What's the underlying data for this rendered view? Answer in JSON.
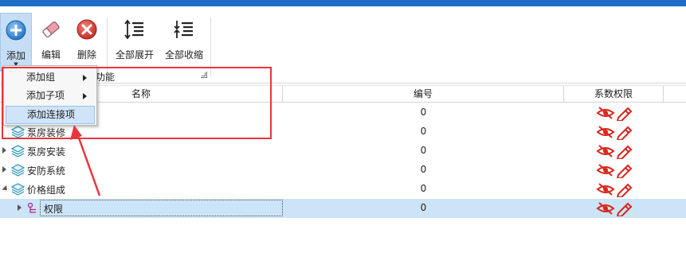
{
  "toolbar": {
    "add_label": "添加",
    "edit_label": "编辑",
    "delete_label": "删除",
    "expand_all_label": "全部展开",
    "collapse_all_label": "全部收缩",
    "group_label": "功能"
  },
  "grid": {
    "columns": [
      "名称",
      "编号",
      "系数权限"
    ],
    "rows": [
      {
        "name": "",
        "code": "0"
      },
      {
        "name": "泵房装修",
        "code": "0"
      },
      {
        "name": "泵房安装",
        "code": "0"
      },
      {
        "name": "安防系统",
        "code": "0"
      },
      {
        "name": "价格组成",
        "code": "0"
      },
      {
        "name": "权限",
        "code": "0"
      }
    ]
  },
  "menu": {
    "items": [
      "添加组",
      "添加子项",
      "添加连接项"
    ]
  },
  "colors": {
    "accent_bar": "#1c6ec6",
    "selected_row": "#cce4f7",
    "permission_icon": "#d9261c",
    "highlight_box": "#e8353d"
  },
  "icons": {
    "add": "plus-circle-icon",
    "edit": "eraser-icon",
    "delete": "close-circle-icon",
    "expand_all": "expand-list-icon",
    "collapse_all": "collapse-list-icon",
    "node": "layers-icon",
    "child_node": "tree-branch-icon",
    "permission": "eye-off-pencil-icon"
  }
}
